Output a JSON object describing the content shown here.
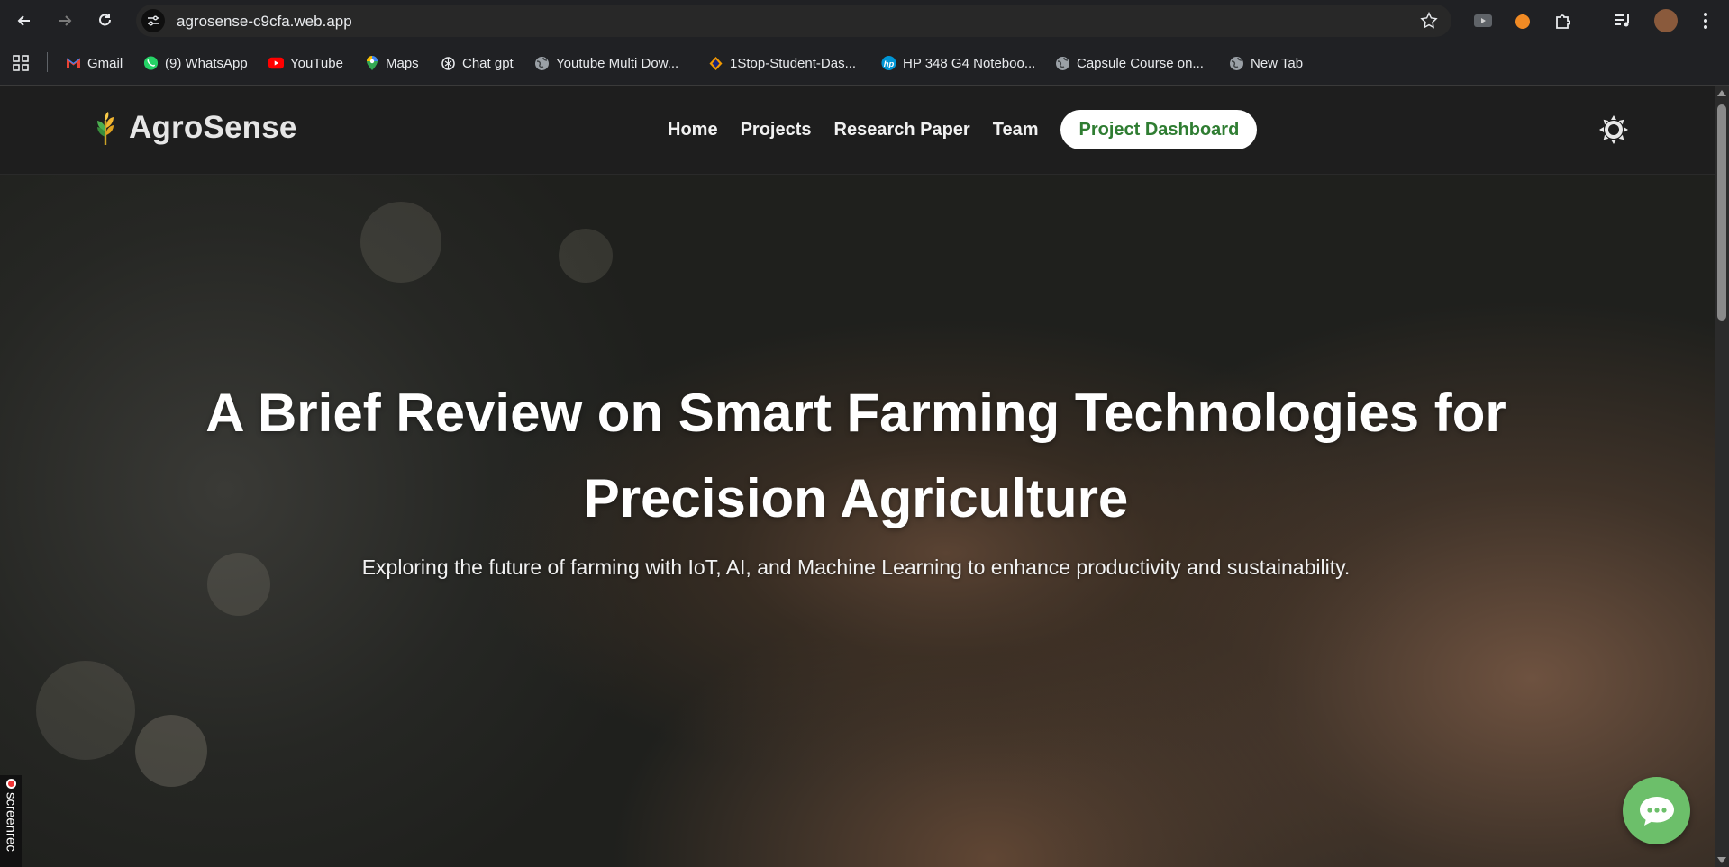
{
  "browser": {
    "url": "agrosense-c9cfa.web.app",
    "bookmarks": [
      {
        "label": "Gmail",
        "icon": "gmail-icon"
      },
      {
        "label": "(9) WhatsApp",
        "icon": "whatsapp-icon"
      },
      {
        "label": "YouTube",
        "icon": "youtube-icon"
      },
      {
        "label": "Maps",
        "icon": "maps-icon"
      },
      {
        "label": "Chat gpt",
        "icon": "chatgpt-icon"
      },
      {
        "label": "Youtube Multi Dow...",
        "icon": "globe-icon"
      },
      {
        "label": "1Stop-Student-Das...",
        "icon": "site-icon"
      },
      {
        "label": "HP 348 G4 Noteboo...",
        "icon": "hp-icon"
      },
      {
        "label": "Capsule Course on...",
        "icon": "globe-icon"
      },
      {
        "label": "New Tab",
        "icon": "globe-icon"
      }
    ]
  },
  "site": {
    "brand": "AgroSense",
    "nav": {
      "home": "Home",
      "projects": "Projects",
      "research": "Research Paper",
      "team": "Team",
      "dashboard": "Project Dashboard"
    },
    "accent_color": "#2f7d32",
    "chat_color": "#6cbf6a"
  },
  "hero": {
    "title": "A Brief Review on Smart Farming Technologies for Precision Agriculture",
    "subtitle": "Exploring the future of farming with IoT, AI, and Machine Learning to enhance productivity and sustainability."
  },
  "overlay": {
    "screenrec_label": "screenrec"
  }
}
